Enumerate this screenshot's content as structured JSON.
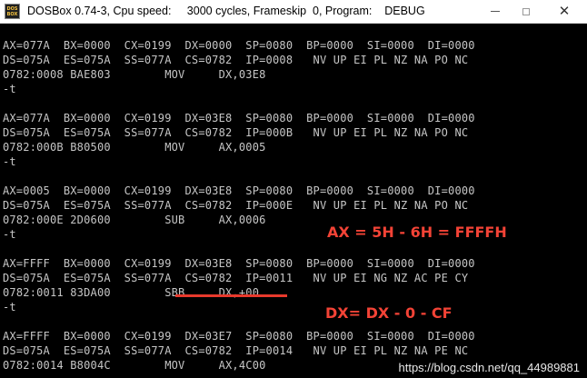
{
  "window": {
    "icon_line1": "DOS",
    "icon_line2": "BOX",
    "title": "DOSBox 0.74-3, Cpu speed:     3000 cycles, Frameskip  0, Program:    DEBUG",
    "minimize_label": "",
    "maximize_label": "",
    "close_label": "✕"
  },
  "terminal": {
    "lines": [
      "",
      "AX=077A  BX=0000  CX=0199  DX=0000  SP=0080  BP=0000  SI=0000  DI=0000",
      "DS=075A  ES=075A  SS=077A  CS=0782  IP=0008   NV UP EI PL NZ NA PO NC",
      "0782:0008 BAE803        MOV     DX,03E8",
      "-t",
      "",
      "AX=077A  BX=0000  CX=0199  DX=03E8  SP=0080  BP=0000  SI=0000  DI=0000",
      "DS=075A  ES=075A  SS=077A  CS=0782  IP=000B   NV UP EI PL NZ NA PO NC",
      "0782:000B B80500        MOV     AX,0005",
      "-t",
      "",
      "AX=0005  BX=0000  CX=0199  DX=03E8  SP=0080  BP=0000  SI=0000  DI=0000",
      "DS=075A  ES=075A  SS=077A  CS=0782  IP=000E   NV UP EI PL NZ NA PO NC",
      "0782:000E 2D0600        SUB     AX,0006",
      "-t",
      "",
      "AX=FFFF  BX=0000  CX=0199  DX=03E8  SP=0080  BP=0000  SI=0000  DI=0000",
      "DS=075A  ES=075A  SS=077A  CS=0782  IP=0011   NV UP EI NG NZ AC PE CY",
      "0782:0011 83DA00        SBB     DX,+00",
      "-t",
      "",
      "AX=FFFF  BX=0000  CX=0199  DX=03E7  SP=0080  BP=0000  SI=0000  DI=0000",
      "DS=075A  ES=075A  SS=077A  CS=0782  IP=0014   NV UP EI PL NZ NA PE NC",
      "0782:0014 B8004C        MOV     AX,4C00"
    ]
  },
  "annotations": {
    "sub_note": "AX = 5H - 6H = FFFFH",
    "sbb_note": "DX= DX - 0 - CF",
    "accent_color": "#f34336"
  },
  "watermark": "https://blog.csdn.net/qq_44989881"
}
